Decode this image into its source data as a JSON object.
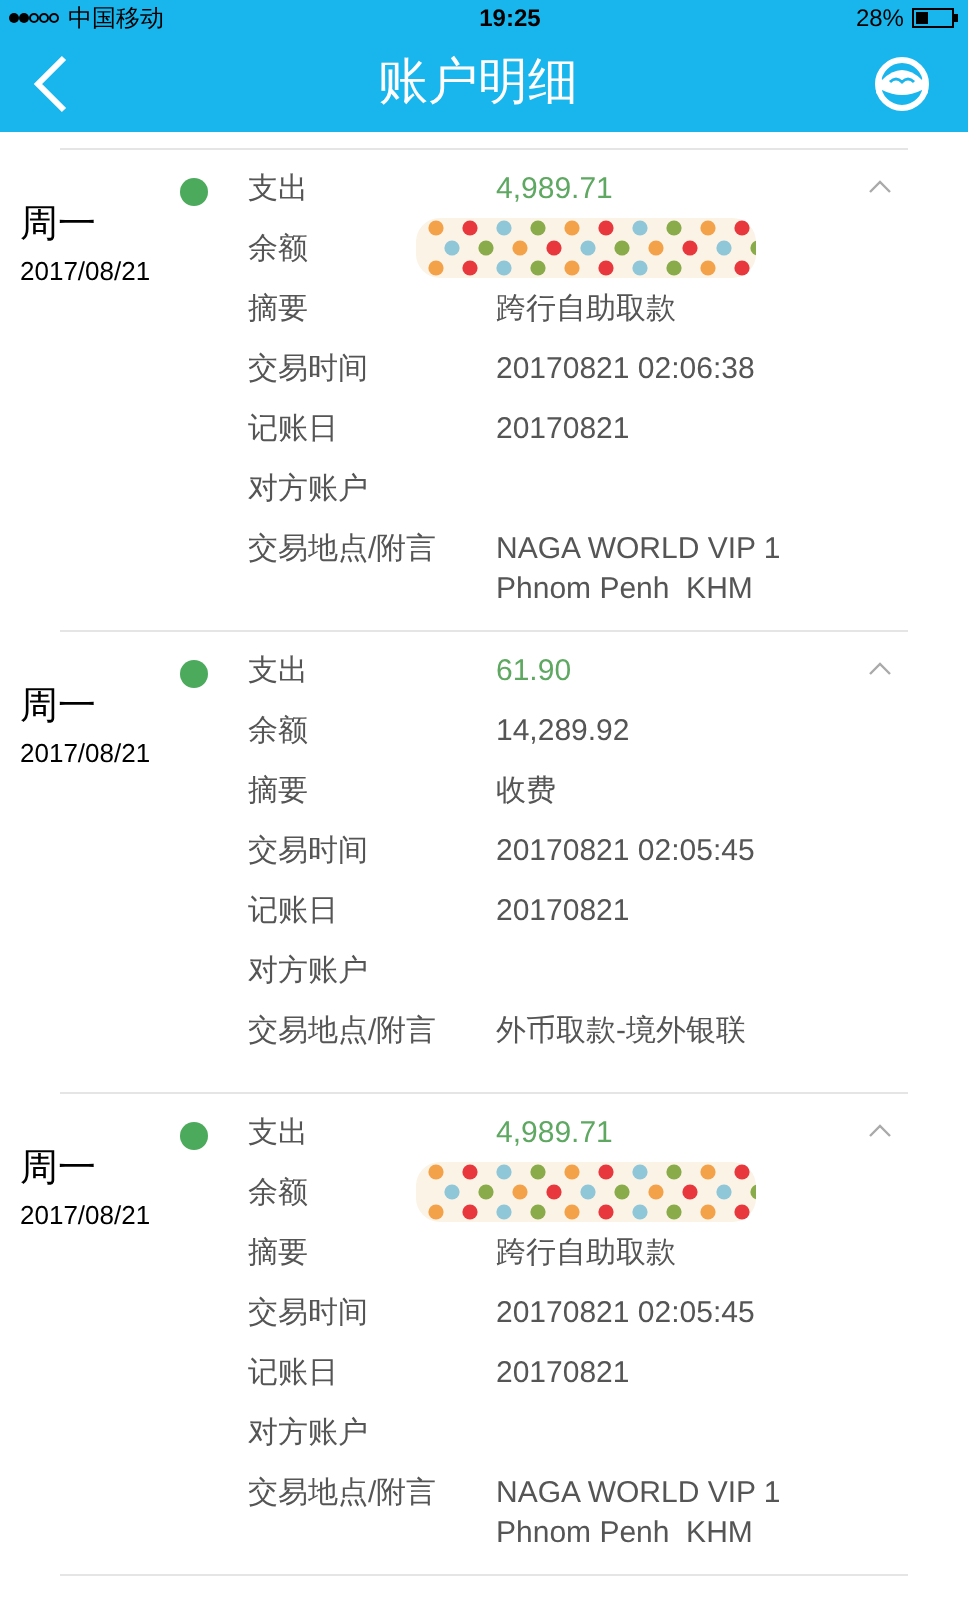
{
  "status_bar": {
    "carrier": "中国移动",
    "time": "19:25",
    "battery": "28%"
  },
  "header": {
    "title": "账户明细"
  },
  "records": [
    {
      "weekday": "周一",
      "date": "2017/08/21",
      "expanded": true,
      "fields": [
        {
          "label": "支出",
          "value": "4,989.71",
          "kind": "amount"
        },
        {
          "label": "余额",
          "kind": "redacted"
        },
        {
          "label": "摘要",
          "value": "跨行自助取款",
          "kind": "text"
        },
        {
          "label": "交易时间",
          "value": "20170821 02:06:38",
          "kind": "text"
        },
        {
          "label": "记账日",
          "value": "20170821",
          "kind": "text"
        },
        {
          "label": "对方账户",
          "kind": "empty"
        },
        {
          "label": "交易地点/附言",
          "value": "NAGA WORLD VIP 1\nPhnom Penh  KHM",
          "kind": "text"
        }
      ]
    },
    {
      "weekday": "周一",
      "date": "2017/08/21",
      "expanded": true,
      "fields": [
        {
          "label": "支出",
          "value": "61.90",
          "kind": "amount"
        },
        {
          "label": "余额",
          "value": "14,289.92",
          "kind": "text"
        },
        {
          "label": "摘要",
          "value": "收费",
          "kind": "text"
        },
        {
          "label": "交易时间",
          "value": "20170821 02:05:45",
          "kind": "text"
        },
        {
          "label": "记账日",
          "value": "20170821",
          "kind": "text"
        },
        {
          "label": "对方账户",
          "kind": "empty"
        },
        {
          "label": "交易地点/附言",
          "value": "外币取款-境外银联",
          "kind": "text"
        }
      ]
    },
    {
      "weekday": "周一",
      "date": "2017/08/21",
      "expanded": true,
      "fields": [
        {
          "label": "支出",
          "value": "4,989.71",
          "kind": "amount"
        },
        {
          "label": "余额",
          "kind": "redacted"
        },
        {
          "label": "摘要",
          "value": "跨行自助取款",
          "kind": "text"
        },
        {
          "label": "交易时间",
          "value": "20170821 02:05:45",
          "kind": "text"
        },
        {
          "label": "记账日",
          "value": "20170821",
          "kind": "text"
        },
        {
          "label": "对方账户",
          "kind": "empty"
        },
        {
          "label": "交易地点/附言",
          "value": "NAGA WORLD VIP 1\nPhnom Penh  KHM",
          "kind": "text"
        }
      ]
    }
  ]
}
